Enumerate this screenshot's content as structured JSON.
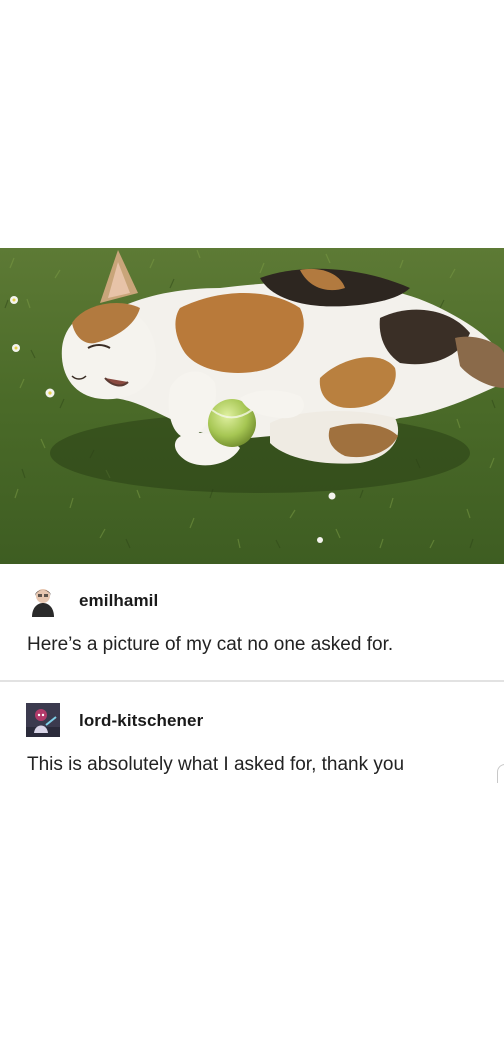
{
  "photo": {
    "icon": "calico-cat-with-tennis-ball-photo"
  },
  "posts": [
    {
      "username": "emilhamil",
      "text": "Here’s a picture of my cat no one asked for.",
      "avatar_icon": "person-avatar"
    },
    {
      "username": "lord-kitschener",
      "text": "This is absolutely what I asked for, thank you",
      "avatar_icon": "cartoon-character-avatar"
    }
  ],
  "colors": {
    "background": "#ffffff",
    "text": "#222222",
    "divider": "#e2e2e2",
    "grass": "#4e6f2c"
  }
}
